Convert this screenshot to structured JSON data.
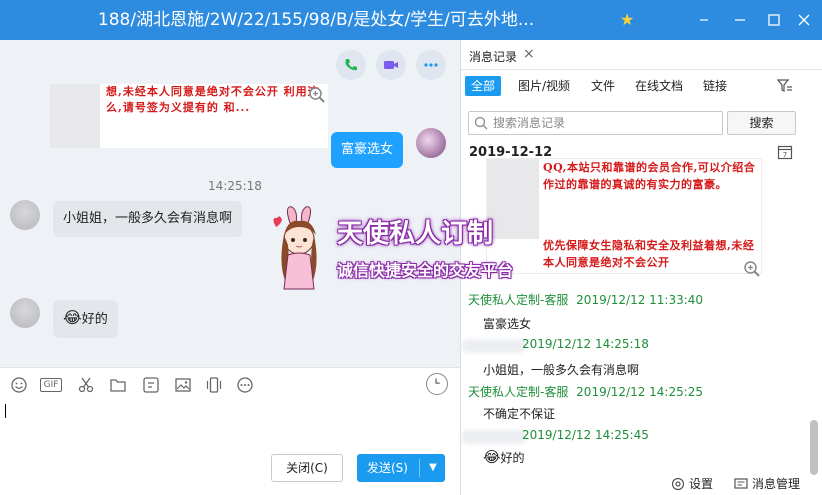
{
  "window": {
    "title": "188/湖北恩施/2W/22/155/98/B/是处女/学生/可去外地...",
    "buttons": [
      "minimize",
      "restore",
      "maximize",
      "close"
    ]
  },
  "chat": {
    "top_icons": [
      "phone-icon",
      "video-icon",
      "more-icon"
    ],
    "image_snippet_text": "想,未经本人同意是绝对不会公开 利用这么,请号签为义提有的 和...",
    "messages": [
      {
        "type": "out",
        "text": "富豪选女"
      },
      {
        "type": "time",
        "text": "14:25:18"
      },
      {
        "type": "in",
        "text": "小姐姐，一般多久会有消息啊"
      },
      {
        "type": "in",
        "text": "好的",
        "emoji": "😂"
      }
    ]
  },
  "toolbar": {
    "icons": [
      "emoji-icon",
      "gif-icon",
      "scissors-icon",
      "folder-icon",
      "sticker-icon",
      "image-icon",
      "shake-icon",
      "more-icon"
    ],
    "gif_label": "GIF"
  },
  "input": {
    "close_label": "关闭(C)",
    "send_label": "发送(S)",
    "value": ""
  },
  "right_panel": {
    "tab_label": "消息记录",
    "filters": [
      "全部",
      "图片/视频",
      "文件",
      "在线文档",
      "链接"
    ],
    "search_placeholder": "搜索消息记录",
    "search_button": "搜索",
    "date": "2019-12-12",
    "image_text_top": "QQ,本站只和靠谱的会员合作,可以介绍合作过的靠谱的真诚的有实力的富豪。",
    "image_text_bottom": "优先保障女生隐私和安全及利益着想,未经本人同意是绝对不会公开",
    "records": [
      {
        "sender": "天使私人定制-客服",
        "time": "2019/12/12 11:33:40",
        "message": "富豪选女"
      },
      {
        "sender": "",
        "time": "2019/12/12 14:25:18",
        "message": "小姐姐，一般多久会有消息啊"
      },
      {
        "sender": "天使私人定制-客服",
        "time": "2019/12/12 14:25:25",
        "message": "不确定不保证"
      },
      {
        "sender": "",
        "time": "2019/12/12 14:25:45",
        "message": "好的",
        "emoji": "😂"
      }
    ],
    "footer": {
      "settings": "设置",
      "manage": "消息管理"
    }
  },
  "watermark": {
    "title": "天使私人订制",
    "subtitle": "诚信快捷安全的交友平台"
  }
}
